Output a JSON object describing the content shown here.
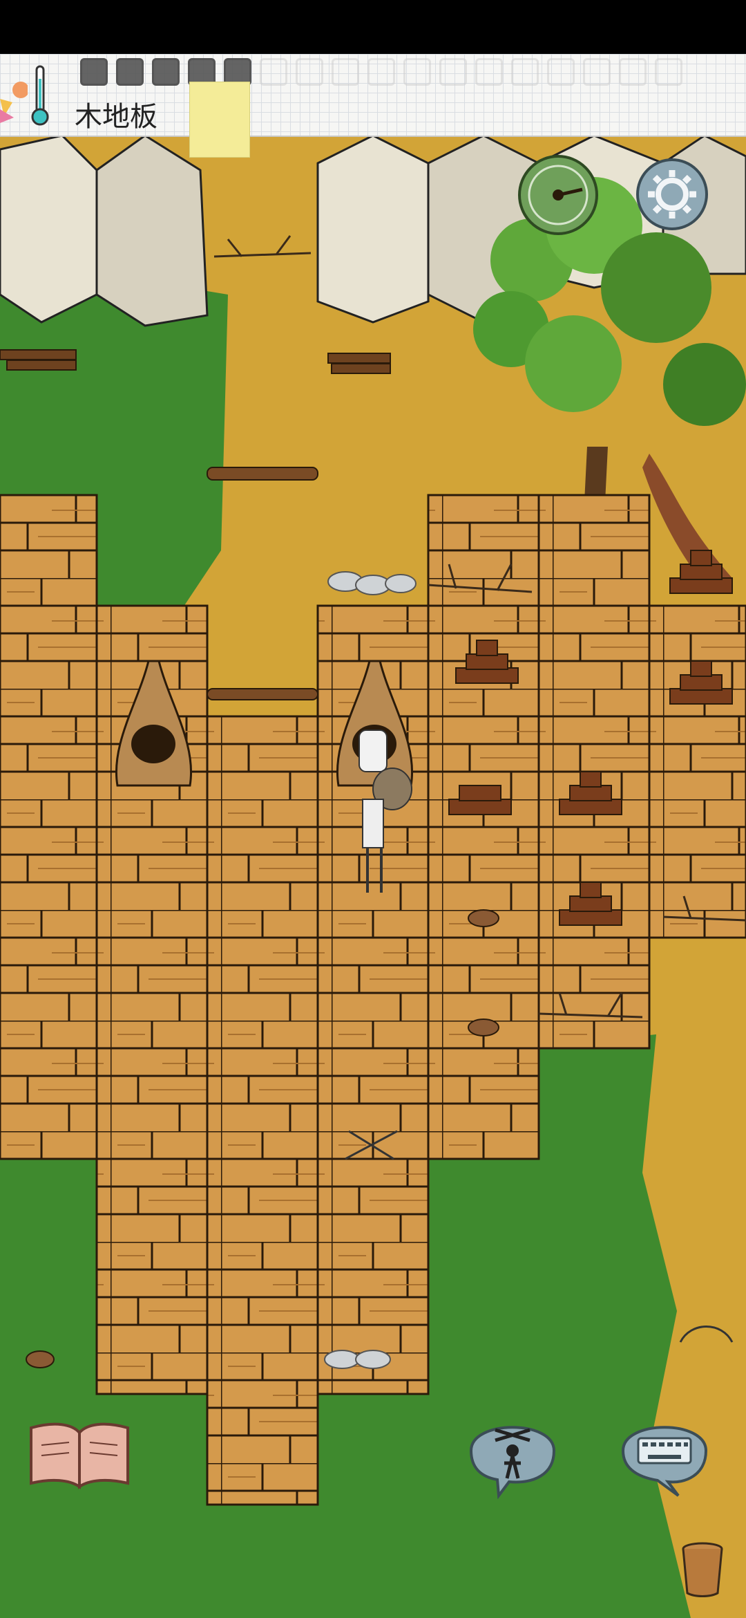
{
  "header": {
    "tile_label": "木地板",
    "icons": [
      "thermometer-icon",
      "inventory-slot-icon"
    ]
  },
  "hud": {
    "compass_icon": "compass-icon",
    "settings_icon": "gear-icon",
    "journal_icon": "open-book-icon",
    "emote_icon": "puppet-icon",
    "keyboard_icon": "keyboard-icon",
    "basket_icon": "basket-icon"
  },
  "colors": {
    "floor": "#d49a4c",
    "floor_line": "#2a1a0a",
    "grass": "#3f8a2e",
    "dry_grass": "#d2a437",
    "wall": "#e8e3d2"
  }
}
